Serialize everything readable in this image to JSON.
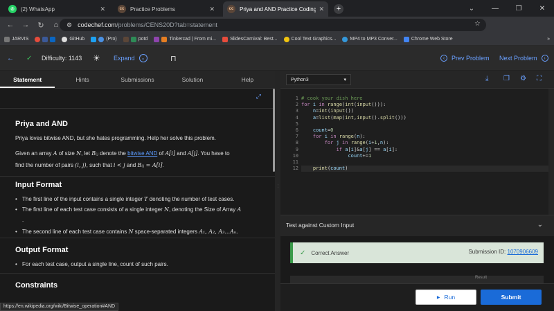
{
  "browser": {
    "tabs": [
      {
        "label": "(2) WhatsApp",
        "active": false
      },
      {
        "label": "Practice Problems",
        "active": false
      },
      {
        "label": "Priya and AND Practice Coding",
        "active": true
      }
    ],
    "url_host": "codechef.com",
    "url_path": "/problems/CENS20D?tab=statement",
    "bookmarks": [
      "JARVIS",
      "GitHub",
      "(Pro)",
      "potd",
      "Tinkercad | From mi...",
      "SlidesCarnival: Best...",
      "Cool Text Graphics...",
      "MP4 to MP3 Conver...",
      "Chrome Web Store"
    ],
    "status_url": "https://en.wikipedia.org/wiki/Bitwise_operation#AND"
  },
  "header": {
    "difficulty": "Difficulty: 1143",
    "expand": "Expand",
    "prev": "Prev Problem",
    "next": "Next Problem"
  },
  "left_tabs": [
    "Statement",
    "Hints",
    "Submissions",
    "Solution",
    "Help"
  ],
  "problem": {
    "title": "Priya and AND",
    "intro": "Priya loves bitwise AND, but she hates programming. Help her solve this problem.",
    "given_a": "Given an array",
    "given_b": "of size",
    "given_c": ", let",
    "given_d": "denote the",
    "given_link": "bitwise AND",
    "given_e": "of",
    "given_f": "and",
    "given_g": ". You have to",
    "find_a": "find the number of pairs",
    "find_b": ", such that",
    "find_c": "and",
    "find_d": ".",
    "input_title": "Input Format",
    "input_1a": "The first line of the input contains a single integer",
    "input_1b": "denoting the number of test cases.",
    "input_2a": "The first line of each test case consists of a single integer",
    "input_2b": ", denoting the Size of Array",
    "input_2c": ".",
    "input_3a": "The second line of each test case contains",
    "input_3b": "space-separated integers",
    "output_title": "Output Format",
    "output_1": "For each test case, output a single line, count of such pairs.",
    "constraints_title": "Constraints"
  },
  "math": {
    "A": "A",
    "N": "N",
    "Bij": "Bᵢⱼ",
    "Ai": "A[i]",
    "Aj": "A[j]",
    "pair": "(i, j)",
    "iltj": "i < j",
    "eq": "Bᵢⱼ = A[i]",
    "T": "T",
    "seq": "A₁, A₂, A₃...Aₙ."
  },
  "editor": {
    "language": "Python3",
    "line_numbers": [
      "1",
      "2",
      "3",
      "4",
      "5",
      "6",
      "7",
      "8",
      "9",
      "10",
      "11",
      "12"
    ]
  },
  "test": {
    "title": "Test against Custom Input",
    "result": "Correct Answer",
    "submission_label": "Submission ID:",
    "submission_id": "1070906609",
    "result_hint": "Result"
  },
  "actions": {
    "run": "Run",
    "submit": "Submit"
  }
}
